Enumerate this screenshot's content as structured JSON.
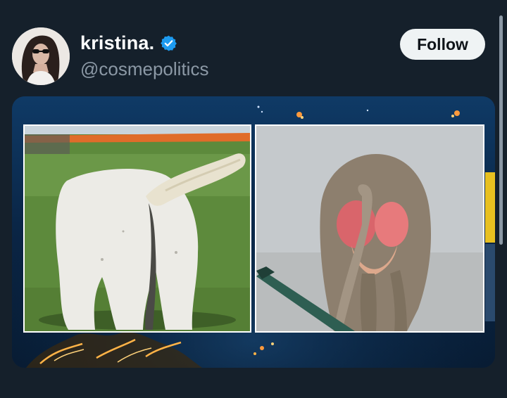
{
  "user": {
    "display_name": "kristina.",
    "handle": "@cosmepolitics",
    "verified": true,
    "avatar_icon": "profile-photo",
    "verified_icon": "verified-badge-icon"
  },
  "actions": {
    "follow_label": "Follow"
  },
  "media": {
    "left_image": "white horse from behind in grass field",
    "right_image": "baboon from behind against concrete wall"
  },
  "colors": {
    "background": "#15202b",
    "display_name": "#ffffff",
    "handle": "#8b98a5",
    "follow_button_bg": "#eff3f4",
    "follow_button_text": "#0f1419",
    "verified_badge": "#1d9bf0"
  }
}
